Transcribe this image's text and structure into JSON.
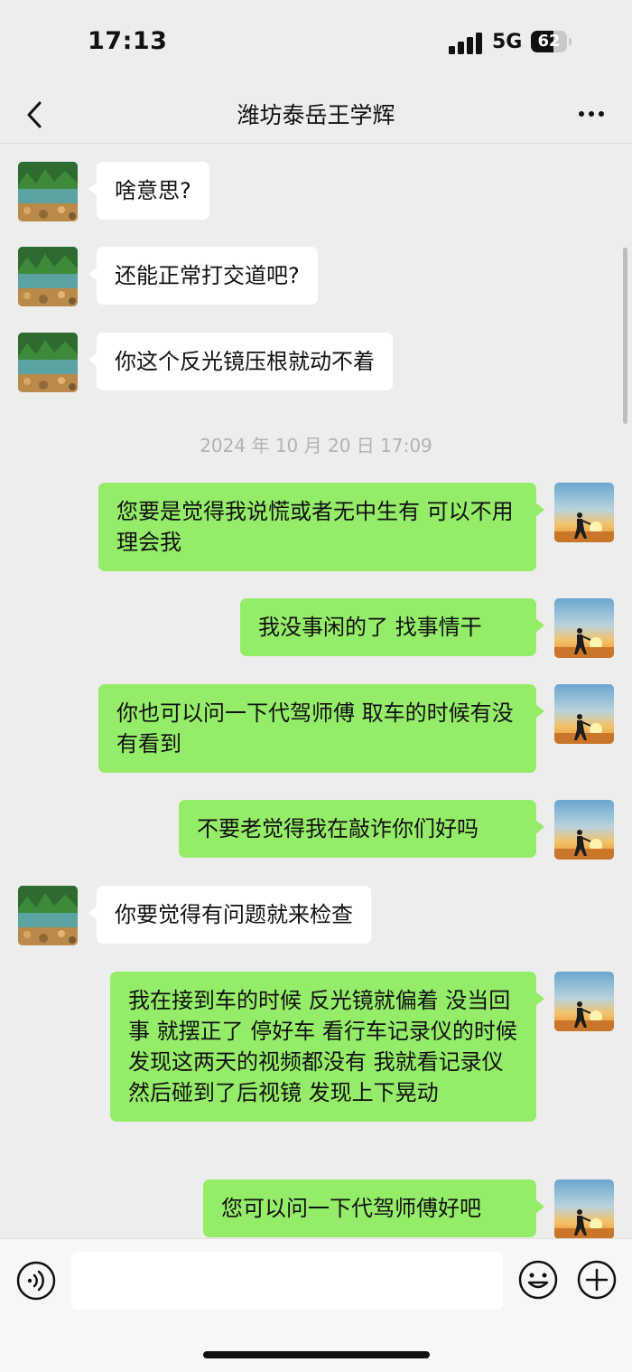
{
  "status_bar": {
    "time": "17:13",
    "network": "5G",
    "battery_level": "62"
  },
  "header": {
    "title": "潍坊泰岳王学辉",
    "back_icon": "chevron-left-icon",
    "more_icon": "more-horizontal-icon"
  },
  "messages": [
    {
      "type": "in",
      "text": "啥意思?"
    },
    {
      "type": "in",
      "text": "还能正常打交道吧?"
    },
    {
      "type": "in",
      "text": "你这个反光镜压根就动不着"
    },
    {
      "type": "timestamp",
      "text": "2024 年 10 月 20 日 17:09"
    },
    {
      "type": "out",
      "text": "您要是觉得我说慌或者无中生有 可以不用理会我"
    },
    {
      "type": "out",
      "text": "我没事闲的了 找事情干"
    },
    {
      "type": "out",
      "text": "你也可以问一下代驾师傅 取车的时候有没有看到"
    },
    {
      "type": "out",
      "text": "不要老觉得我在敲诈你们好吗"
    },
    {
      "type": "in",
      "text": "你要觉得有问题就来检查"
    },
    {
      "type": "out",
      "text": "我在接到车的时候 反光镜就偏着 没当回事 就摆正了 停好车 看行车记录仪的时候 发现这两天的视频都没有 我就看记录仪 然后碰到了后视镜 发现上下晃动"
    },
    {
      "type": "out",
      "text": "您可以问一下代驾师傅好吧"
    }
  ],
  "input_bar": {
    "placeholder": "",
    "voice_icon": "voice-icon",
    "emoji_icon": "emoji-icon",
    "plus_icon": "plus-circle-icon"
  },
  "colors": {
    "background": "#ededed",
    "bubble_out": "#95ec69",
    "bubble_in": "#ffffff",
    "timestamp": "#b2b2b2"
  }
}
